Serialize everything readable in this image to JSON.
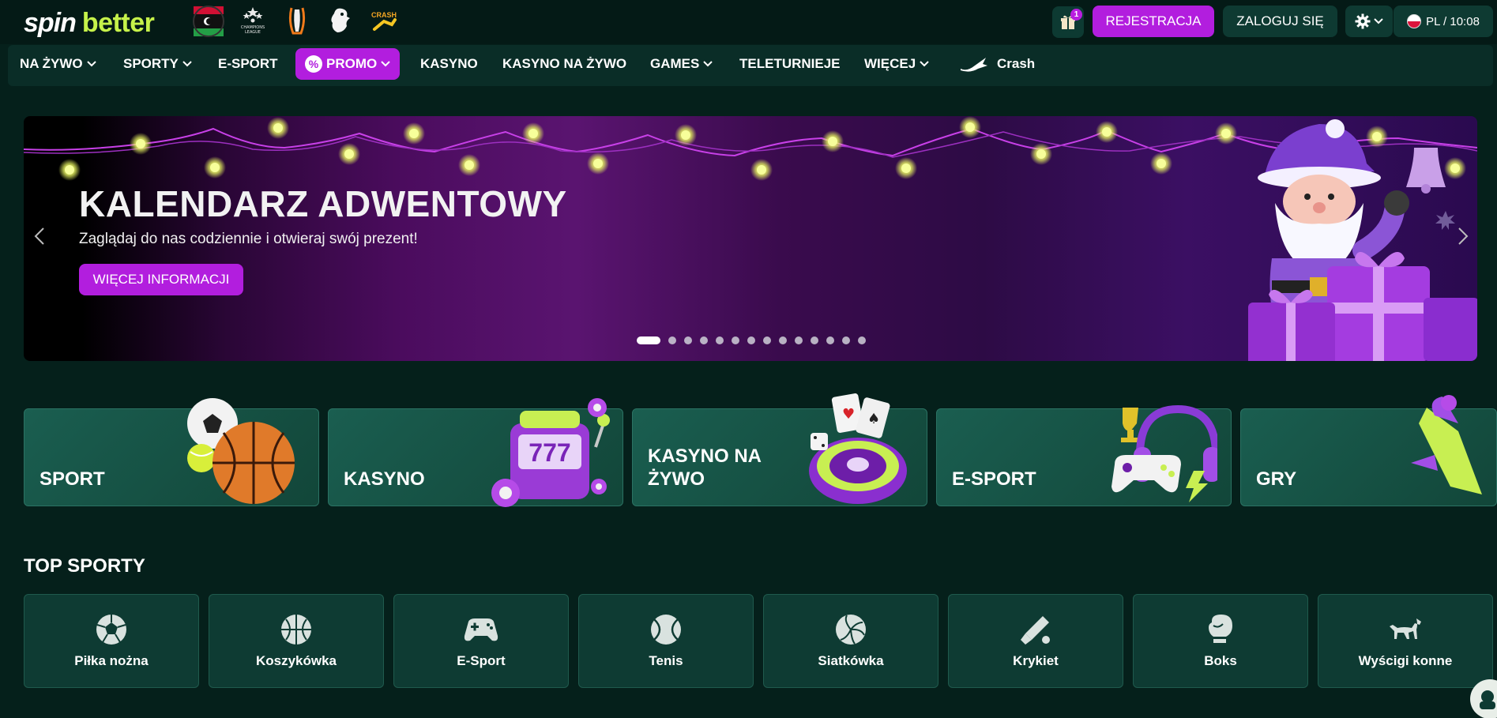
{
  "header": {
    "logo_left": "spin",
    "logo_right": "better",
    "gift_count": "1",
    "register_label": "REJESTRACJA",
    "login_label": "ZALOGUJ SIĘ",
    "language": "PL",
    "time": "10:08",
    "lang_time_label": "PL / 10:08"
  },
  "nav": {
    "items": [
      {
        "label": "NA ŻYWO"
      },
      {
        "label": "SPORTY"
      },
      {
        "label": "E-SPORT"
      },
      {
        "label": "PROMO"
      },
      {
        "label": "KASYNO"
      },
      {
        "label": "KASYNO NA ŻYWO"
      },
      {
        "label": "GAMES"
      },
      {
        "label": "TELETURNIEJE"
      },
      {
        "label": "WIĘCEJ"
      },
      {
        "label": "Crash"
      }
    ]
  },
  "banner": {
    "title": "KALENDARZ ADWENTOWY",
    "subtitle": "Zaglądaj do nas codziennie i otwieraj swój prezent!",
    "cta_label": "WIĘCEJ INFORMACJI",
    "slide_count": 14,
    "active_slide": 1
  },
  "categories": [
    {
      "label": "SPORT"
    },
    {
      "label": "KASYNO"
    },
    {
      "label": "KASYNO NA ŻYWO"
    },
    {
      "label": "E-SPORT"
    },
    {
      "label": "GRY"
    }
  ],
  "top_sports": {
    "title": "TOP SPORTY",
    "items": [
      {
        "label": "Piłka nożna",
        "icon": "soccer-ball-icon"
      },
      {
        "label": "Koszykówka",
        "icon": "basketball-icon"
      },
      {
        "label": "E-Sport",
        "icon": "gamepad-icon"
      },
      {
        "label": "Tenis",
        "icon": "tennis-ball-icon"
      },
      {
        "label": "Siatkówka",
        "icon": "volleyball-icon"
      },
      {
        "label": "Krykiet",
        "icon": "cricket-bat-icon"
      },
      {
        "label": "Boks",
        "icon": "boxing-glove-icon"
      },
      {
        "label": "Wyścigi konne",
        "icon": "horse-icon"
      }
    ]
  },
  "colors": {
    "background": "#05201b",
    "accent_purple": "#b21ede",
    "logo_green": "#c6f24a",
    "card_green": "#1a5e50"
  }
}
